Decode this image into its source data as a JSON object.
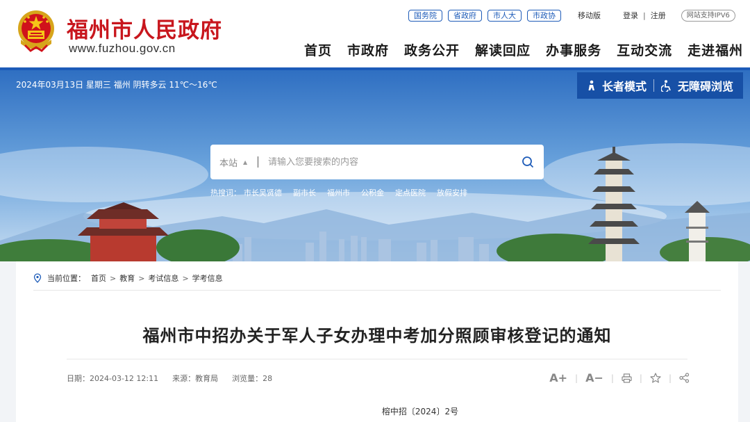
{
  "header": {
    "site_name": "福州市人民政府",
    "site_url": "www.fuzhou.gov.cn",
    "gov_links": [
      "国务院",
      "省政府",
      "市人大",
      "市政协"
    ],
    "mobile": "移动版",
    "login": "登录",
    "separator": "|",
    "register": "注册",
    "ipv6": "网站支持IPV6",
    "nav": [
      "首页",
      "市政府",
      "政务公开",
      "解读回应",
      "办事服务",
      "互动交流",
      "走进福州"
    ]
  },
  "banner": {
    "date_weather": "2024年03月13日 星期三  福州 阴转多云 11℃～16℃",
    "elder_mode": "长者模式",
    "accessible": "无障碍浏览",
    "search_scope": "本站",
    "search_placeholder": "请输入您要搜索的内容",
    "hot_label": "热搜词：",
    "hot_words": [
      "市长吴贤德",
      "副市长",
      "福州市",
      "公积金",
      "定点医院",
      "放假安排"
    ]
  },
  "article": {
    "location_label": "当前位置：",
    "breadcrumb": [
      "首页",
      "教育",
      "考试信息",
      "学考信息"
    ],
    "breadcrumb_sep": ">",
    "title": "福州市中招办关于军人子女办理中考加分照顾审核登记的通知",
    "date": "日期：2024-03-12 12:11",
    "source": "来源：教育局",
    "views": "浏览量：28",
    "doc_number": "榕中招〔2024〕2号",
    "tools": [
      "A+",
      "A−"
    ]
  },
  "colors": {
    "brand_red": "#c8161d",
    "brand_blue": "#1d5bb8",
    "access_bar": "#1750a6"
  }
}
